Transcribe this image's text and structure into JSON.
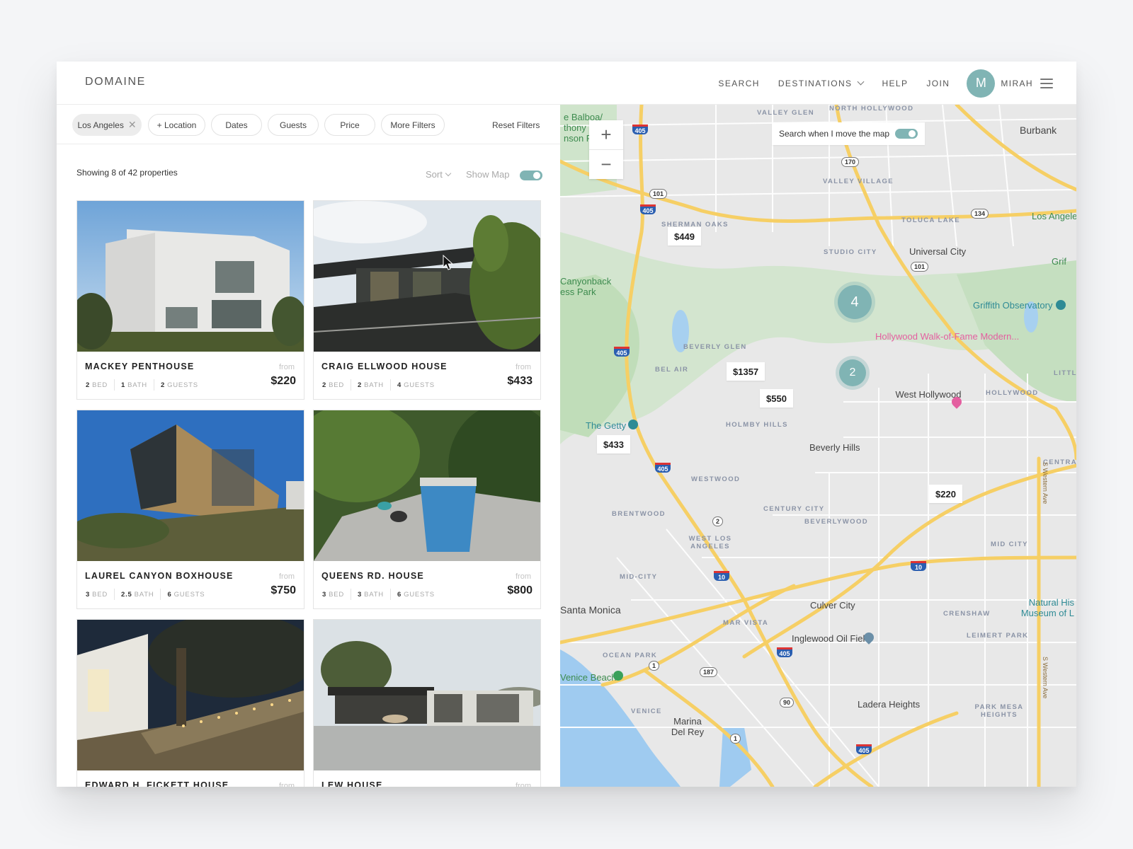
{
  "header": {
    "logo": "DOMAINE",
    "nav": [
      {
        "label": "SEARCH"
      },
      {
        "label": "DESTINATIONS",
        "has_dropdown": true
      },
      {
        "label": "HELP"
      },
      {
        "label": "JOIN"
      }
    ],
    "user": {
      "initial": "M",
      "name": "MIRAH",
      "avatar_color": "#80b4b4"
    }
  },
  "filters": {
    "active_chip": {
      "label": "Los Angeles",
      "remove_icon": "close-icon"
    },
    "chips": [
      {
        "label": "+ Location"
      },
      {
        "label": "Dates"
      },
      {
        "label": "Guests"
      },
      {
        "label": "Price"
      },
      {
        "label": "More Filters"
      }
    ],
    "reset_label": "Reset Filters"
  },
  "results": {
    "showing_text": "Showing 8 of 42 properties",
    "sort_label": "Sort",
    "show_map_label": "Show Map",
    "show_map_on": true
  },
  "listings": [
    {
      "title": "MACKEY PENTHOUSE",
      "bed": "2",
      "bath": "1",
      "guests": "2",
      "from_label": "from",
      "price": "$220"
    },
    {
      "title": "CRAIG ELLWOOD HOUSE",
      "bed": "2",
      "bath": "2",
      "guests": "4",
      "from_label": "from",
      "price": "$433"
    },
    {
      "title": "LAUREL CANYON BOXHOUSE",
      "bed": "3",
      "bath": "2.5",
      "guests": "6",
      "from_label": "from",
      "price": "$750"
    },
    {
      "title": "QUEENS RD. HOUSE",
      "bed": "3",
      "bath": "3",
      "guests": "6",
      "from_label": "from",
      "price": "$800"
    },
    {
      "title": "EDWARD H. FICKETT HOUSE",
      "from_label": "from"
    },
    {
      "title": "LEW HOUSE",
      "from_label": "from"
    }
  ],
  "spec_labels": {
    "bed": "BED",
    "bath": "BATH",
    "guests": "GUESTS"
  },
  "map": {
    "zoom_in": "+",
    "zoom_out": "−",
    "search_toggle_label": "Search when I move the map",
    "search_toggle_on": true,
    "price_pins": [
      "$449",
      "$1357",
      "$550",
      "$433",
      "$220"
    ],
    "clusters": [
      "4",
      "2"
    ],
    "labels": {
      "cities": [
        "Burbank",
        "Universal City",
        "West Hollywood",
        "Beverly Hills",
        "Santa Monica",
        "Culver City",
        "Ladera Heights",
        "Marina Del Rey",
        "Los Angeles"
      ],
      "neighborhoods": [
        "VALLEY GLEN",
        "NORTH HOLLYWOOD",
        "VALLEY VILLAGE",
        "SHERMAN OAKS",
        "TOLUCA LAKE",
        "STUDIO CITY",
        "BEVERLY GLEN",
        "BEL AIR",
        "HOLMBY HILLS",
        "WESTWOOD",
        "BRENTWOOD",
        "CENTURY CITY",
        "BEVERLYWOOD",
        "WEST LOS ANGELES",
        "MID-CITY",
        "MAR VISTA",
        "OCEAN PARK",
        "VENICE",
        "HOLLYWOOD",
        "LITTLE ARMENIA",
        "CENTRAL LA",
        "MID CITY",
        "CRENSHAW",
        "LEIMERT PARK",
        "PARK MESA HEIGHTS"
      ],
      "parks": [
        "Balboa/ Anthony C. Beilenson Park",
        "Canyonback Wilderness Park",
        "Griffith Park"
      ],
      "pois": [
        "Griffith Observatory",
        "The Getty",
        "Inglewood Oil Field",
        "Venice Beach",
        "Natural History Museum of LA"
      ],
      "hotel": "Hollywood Walk-of-Fame Modern...",
      "streets": [
        "S Western Ave"
      ],
      "shields": [
        "405",
        "101",
        "170",
        "134",
        "10",
        "2",
        "1",
        "187",
        "90"
      ]
    }
  }
}
